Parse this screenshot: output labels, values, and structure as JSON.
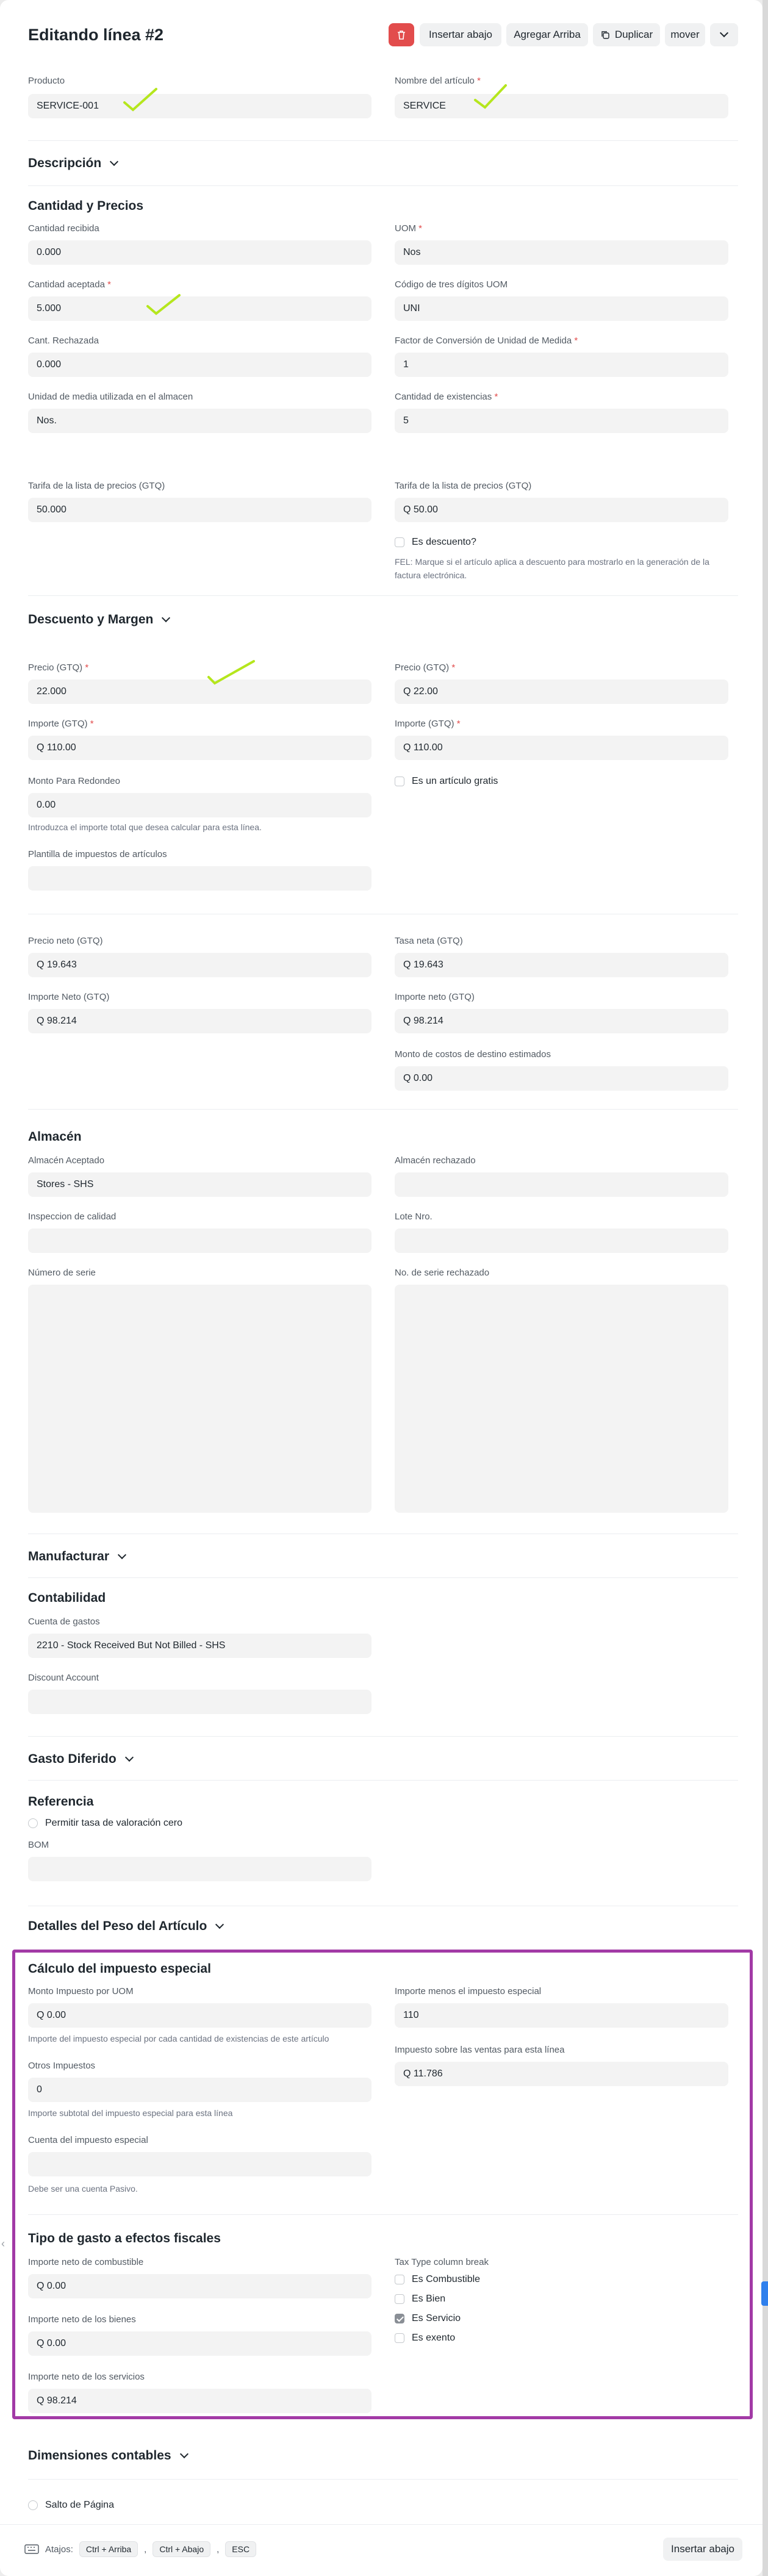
{
  "header": {
    "title": "Editando línea #2",
    "buttons": {
      "insert_below": "Insertar abajo",
      "add_above": "Agregar Arriba",
      "duplicate": "Duplicar",
      "move": "mover"
    }
  },
  "item": {
    "producto_label": "Producto",
    "producto_value": "SERVICE-001",
    "nombre_label": "Nombre del artículo",
    "nombre_value": "SERVICE"
  },
  "descripcion": {
    "title": "Descripción"
  },
  "cantidad": {
    "title": "Cantidad y Precios",
    "recibida_label": "Cantidad recibida",
    "recibida_value": "0.000",
    "uom_label": "UOM",
    "uom_value": "Nos",
    "aceptada_label": "Cantidad aceptada",
    "aceptada_value": "5.000",
    "codigo_label": "Código de tres dígitos UOM",
    "codigo_value": "UNI",
    "rechazada_label": "Cant. Rechazada",
    "rechazada_value": "0.000",
    "factor_label": "Factor de Conversión de Unidad de Medida",
    "factor_value": "1",
    "unidad_label": "Unidad de media utilizada en el almacen",
    "unidad_value": "Nos.",
    "existencias_label": "Cantidad de existencias",
    "existencias_value": "5",
    "tarifa1_label": "Tarifa de la lista de precios (GTQ)",
    "tarifa1_value": "50.000",
    "tarifa2_label": "Tarifa de la lista de precios (GTQ)",
    "tarifa2_value": "Q 50.00",
    "descuento_check": "Es descuento?",
    "descuento_help": "FEL: Marque si el artículo aplica a descuento para mostrarlo en la generación de la factura electrónica."
  },
  "margen": {
    "title": "Descuento y Margen",
    "precio1_label": "Precio (GTQ)",
    "precio1_value": "22.000",
    "precio2_label": "Precio (GTQ)",
    "precio2_value": "Q 22.00",
    "importe1_label": "Importe (GTQ)",
    "importe1_value": "Q 110.00",
    "importe2_label": "Importe (GTQ)",
    "importe2_value": "Q 110.00",
    "redondeo_label": "Monto Para Redondeo",
    "redondeo_value": "0.00",
    "redondeo_help": "Introduzca el importe total que desea calcular para esta línea.",
    "gratis_check": "Es un artículo gratis",
    "plantilla_label": "Plantilla de impuestos de artículos"
  },
  "netos": {
    "precio_neto_label": "Precio neto (GTQ)",
    "precio_neto_value": "Q 19.643",
    "tasa_neta_label": "Tasa neta (GTQ)",
    "tasa_neta_value": "Q 19.643",
    "importe_neto1_label": "Importe Neto (GTQ)",
    "importe_neto1_value": "Q 98.214",
    "importe_neto2_label": "Importe neto (GTQ)",
    "importe_neto2_value": "Q 98.214",
    "costos_label": "Monto de costos de destino estimados",
    "costos_value": "Q 0.00"
  },
  "almacen": {
    "title": "Almacén",
    "aceptado_label": "Almacén Aceptado",
    "aceptado_value": "Stores - SHS",
    "rechazado_label": "Almacén rechazado",
    "calidad_label": "Inspeccion de calidad",
    "lote_label": "Lote Nro.",
    "serie_label": "Número de serie",
    "serie_rech_label": "No. de serie rechazado"
  },
  "manufacturar": {
    "title": "Manufacturar"
  },
  "contabilidad": {
    "title": "Contabilidad",
    "gastos_label": "Cuenta de gastos",
    "gastos_value": "2210 - Stock Received But Not Billed - SHS",
    "discount_label": "Discount Account"
  },
  "gasto_diferido": {
    "title": "Gasto Diferido"
  },
  "referencia": {
    "title": "Referencia",
    "tasa_check": "Permitir tasa de valoración cero",
    "bom_label": "BOM"
  },
  "peso": {
    "title": "Detalles del Peso del Artículo"
  },
  "especial": {
    "title": "Cálculo del impuesto especial",
    "monto_uom_label": "Monto Impuesto por UOM",
    "monto_uom_value": "Q 0.00",
    "monto_uom_help": "Importe del impuesto especial por cada cantidad de existencias de este artículo",
    "menos_label": "Importe menos el impuesto especial",
    "menos_value": "110",
    "ventas_label": "Impuesto sobre las ventas para esta línea",
    "ventas_value": "Q 11.786",
    "otros_label": "Otros Impuestos",
    "otros_value": "0",
    "otros_help": "Importe subtotal del impuesto especial para esta línea",
    "cuenta_label": "Cuenta del impuesto especial",
    "cuenta_help": "Debe ser una cuenta Pasivo."
  },
  "fiscal": {
    "title": "Tipo de gasto a efectos fiscales",
    "combustible_label": "Importe neto de combustible",
    "combustible_value": "Q 0.00",
    "bienes_label": "Importe neto de los bienes",
    "bienes_value": "Q 0.00",
    "servicios_label": "Importe neto de los servicios",
    "servicios_value": "Q 98.214",
    "tax_type_label": "Tax Type column break",
    "opt_combustible": "Es Combustible",
    "opt_bien": "Es Bien",
    "opt_servicio": "Es Servicio",
    "opt_exento": "Es exento"
  },
  "dimensiones": {
    "title": "Dimensiones contables",
    "salto_check": "Salto de Página"
  },
  "footer": {
    "atajos": "Atajos:",
    "k1": "Ctrl + Arriba",
    "k2": "Ctrl + Abajo",
    "k3": "ESC",
    "insert_below": "Insertar abajo"
  },
  "colors": {
    "highlight": "#a23aa6",
    "tick": "#b5e61d",
    "danger": "#e24c4c"
  }
}
